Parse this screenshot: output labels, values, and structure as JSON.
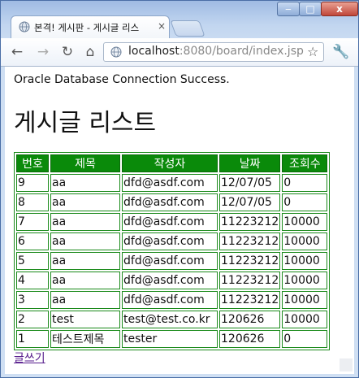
{
  "browser": {
    "tab_title": "본격! 게시판 - 게시글 리스",
    "tab_close": "×",
    "url_host": "localhost",
    "url_rest": ":8080/board/index.jsp",
    "controls": {
      "minimize": "‒",
      "maximize": "□",
      "close": "x"
    }
  },
  "page": {
    "status_text": "Oracle Database Connection Success.",
    "heading": "게시글 리스트",
    "table": {
      "headers": [
        "번호",
        "제목",
        "작성자",
        "날짜",
        "조회수"
      ],
      "rows": [
        [
          "9",
          "aa",
          "dfd@asdf.com",
          "12/07/05",
          "0"
        ],
        [
          "8",
          "aa",
          "dfd@asdf.com",
          "12/07/05",
          "0"
        ],
        [
          "7",
          "aa",
          "dfd@asdf.com",
          "11223212",
          "10000"
        ],
        [
          "6",
          "aa",
          "dfd@asdf.com",
          "11223212",
          "10000"
        ],
        [
          "5",
          "aa",
          "dfd@asdf.com",
          "11223212",
          "10000"
        ],
        [
          "4",
          "aa",
          "dfd@asdf.com",
          "11223212",
          "10000"
        ],
        [
          "3",
          "aa",
          "dfd@asdf.com",
          "11223212",
          "10000"
        ],
        [
          "2",
          "test",
          "test@test.co.kr",
          "120626",
          "10000"
        ],
        [
          "1",
          "테스트제목",
          "tester",
          "120626",
          "0"
        ]
      ]
    },
    "write_link": "글쓰기"
  },
  "colors": {
    "header_bg": "#0a8a0a",
    "border": "#1a8a1a",
    "link": "#551a8b"
  },
  "icons": [
    "globe-icon",
    "back-icon",
    "forward-icon",
    "reload-icon",
    "home-icon",
    "star-icon",
    "wrench-icon"
  ]
}
